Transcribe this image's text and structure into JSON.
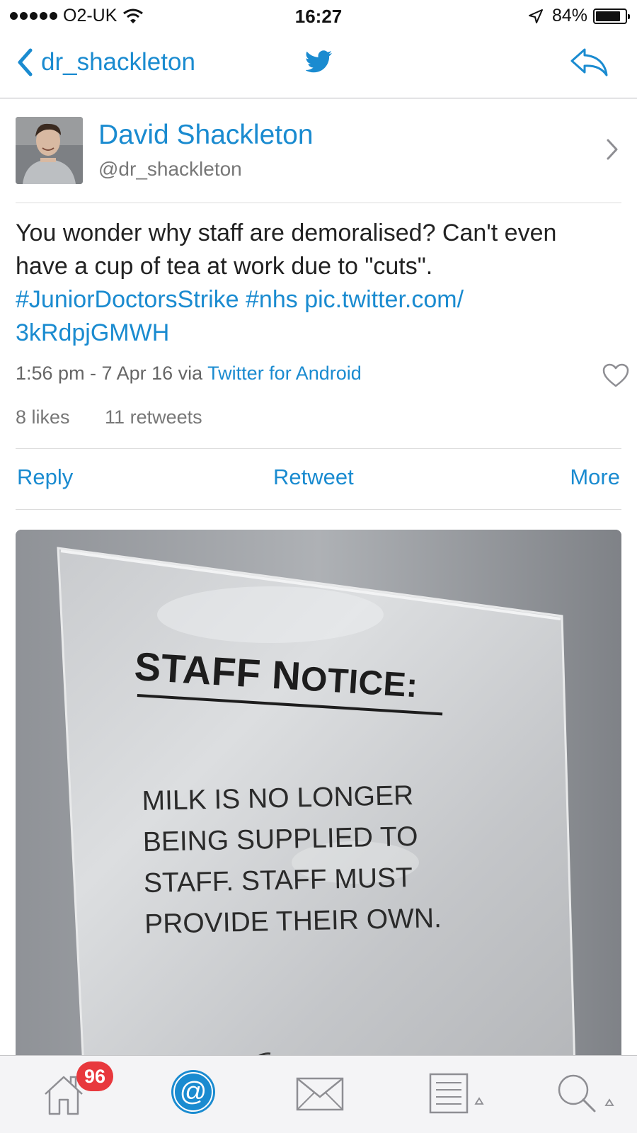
{
  "status_bar": {
    "carrier": "O2-UK",
    "time": "16:27",
    "battery": "84%",
    "battery_level": 0.84
  },
  "nav": {
    "back_label": "dr_shackleton",
    "accent_color": "#1a8bd0"
  },
  "author": {
    "name": "David Shackleton",
    "handle": "@dr_shackleton"
  },
  "tweet": {
    "text": "You wonder why staff are demoralised? Can't even have a cup of tea at work due to \"cuts\".",
    "hashtag_1": "#JuniorDoctorsStrike",
    "hashtag_2": "#nhs",
    "link_1": "pic.twitter.com/",
    "link_2": "3kRdpjGMWH",
    "timestamp": "1:56 pm - 7 Apr 16 via",
    "source": "Twitter for Android",
    "likes": "8 likes",
    "retweets": "11 retweets"
  },
  "actions": {
    "reply": "Reply",
    "retweet": "Retweet",
    "more": "More"
  },
  "photo": {
    "notice_title_part1": "STAFF N",
    "notice_title_part2": "OTICE:",
    "notice_line_1": "MILK IS NO LONGER",
    "notice_line_2": "BEING SUPPLIED TO",
    "notice_line_3": "STAFF. STAFF MUST",
    "notice_line_4": "PROVIDE THEIR OWN."
  },
  "tab_bar": {
    "home_badge": "96",
    "icons": [
      "home-icon",
      "mentions-icon",
      "messages-icon",
      "lists-icon",
      "search-icon"
    ],
    "active_tab": "mentions"
  }
}
